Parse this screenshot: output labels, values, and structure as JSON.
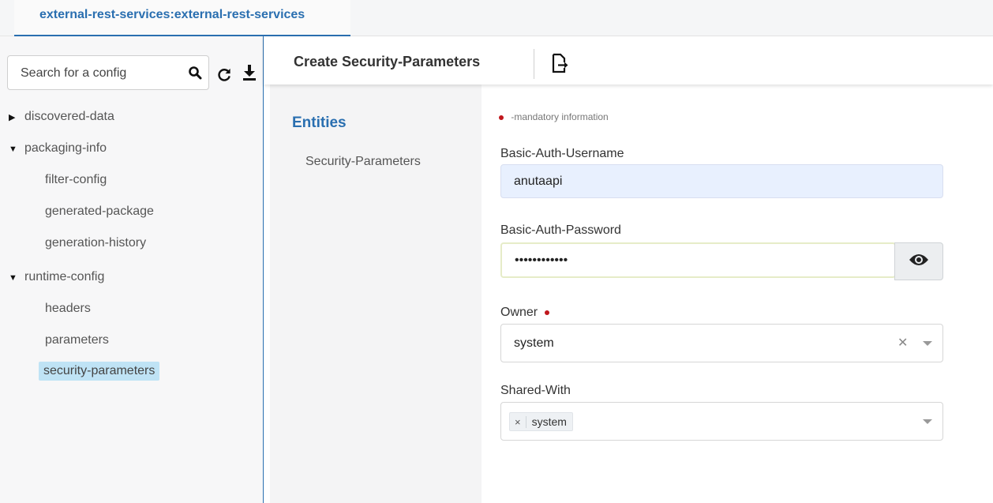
{
  "tab": {
    "label": "external-rest-services:external-rest-services"
  },
  "sidebar": {
    "search_placeholder": "Search for a config",
    "tree": [
      {
        "label": "discovered-data",
        "expanded": false
      },
      {
        "label": "packaging-info",
        "expanded": true,
        "children": [
          "filter-config",
          "generated-package",
          "generation-history"
        ]
      },
      {
        "label": "runtime-config",
        "expanded": true,
        "children": [
          "headers",
          "parameters",
          "security-parameters"
        ]
      }
    ],
    "selected": "security-parameters",
    "icons": {
      "search": "search-icon",
      "refresh": "refresh-icon",
      "download": "download-icon"
    }
  },
  "header": {
    "title": "Create Security-Parameters",
    "export_icon": "export-file-icon"
  },
  "entities": {
    "title": "Entities",
    "items": [
      "Security-Parameters"
    ]
  },
  "form": {
    "mandatory_note": "-mandatory information",
    "username": {
      "label": "Basic-Auth-Username",
      "value": "anutaapi"
    },
    "password": {
      "label": "Basic-Auth-Password",
      "value": "anutaapi1234"
    },
    "owner": {
      "label": "Owner",
      "value": "system",
      "required": true
    },
    "shared_with": {
      "label": "Shared-With",
      "tags": [
        "system"
      ],
      "tag_remove": "×"
    }
  },
  "colors": {
    "accent": "#2a6fb0",
    "required": "#c0171c",
    "selected_bg": "#bfe3f5",
    "autofill_bg": "#e8f0fe"
  }
}
